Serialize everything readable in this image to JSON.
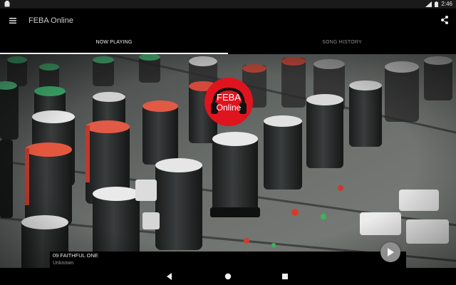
{
  "status_bar": {
    "time": "2:46",
    "icons": [
      "notification-icon",
      "signal-icon",
      "battery-icon"
    ]
  },
  "app_bar": {
    "title": "FEBA Online",
    "menu_icon": "menu-icon",
    "share_icon": "share-icon"
  },
  "tabs": [
    {
      "label": "NOW PLAYING",
      "active": true
    },
    {
      "label": "SONG HISTORY",
      "active": false
    }
  ],
  "logo": {
    "line1": "FEBA",
    "line2": "Online",
    "color": "#e0141e"
  },
  "player": {
    "title": "09 FAITHFUL ONE",
    "artist": "Unknown",
    "play_icon": "play-icon"
  },
  "nav": {
    "back_icon": "back-icon",
    "home_icon": "home-icon",
    "recent_icon": "recent-apps-icon"
  }
}
